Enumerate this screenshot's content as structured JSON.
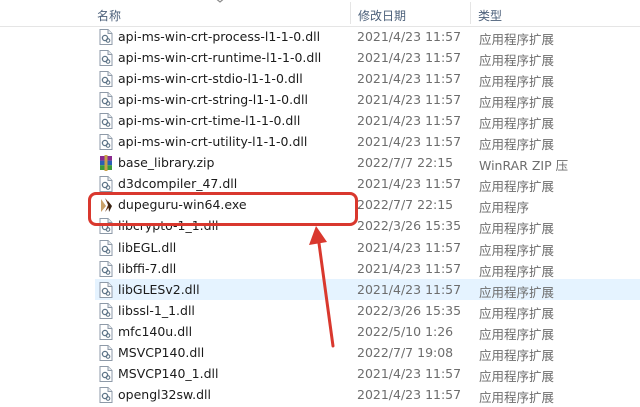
{
  "header": {
    "name_label": "名称",
    "date_label": "修改日期",
    "type_label": "类型"
  },
  "files": [
    {
      "name": "api-ms-win-crt-process-l1-1-0.dll",
      "date": "2021/4/23 11:57",
      "type": "应用程序扩展",
      "icon": "dll-icon"
    },
    {
      "name": "api-ms-win-crt-runtime-l1-1-0.dll",
      "date": "2021/4/23 11:57",
      "type": "应用程序扩展",
      "icon": "dll-icon"
    },
    {
      "name": "api-ms-win-crt-stdio-l1-1-0.dll",
      "date": "2021/4/23 11:57",
      "type": "应用程序扩展",
      "icon": "dll-icon"
    },
    {
      "name": "api-ms-win-crt-string-l1-1-0.dll",
      "date": "2021/4/23 11:57",
      "type": "应用程序扩展",
      "icon": "dll-icon"
    },
    {
      "name": "api-ms-win-crt-time-l1-1-0.dll",
      "date": "2021/4/23 11:57",
      "type": "应用程序扩展",
      "icon": "dll-icon"
    },
    {
      "name": "api-ms-win-crt-utility-l1-1-0.dll",
      "date": "2021/4/23 11:57",
      "type": "应用程序扩展",
      "icon": "dll-icon"
    },
    {
      "name": "base_library.zip",
      "date": "2022/7/7 22:15",
      "type": "WinRAR ZIP 压",
      "icon": "zip-archive-icon"
    },
    {
      "name": "d3dcompiler_47.dll",
      "date": "2021/4/23 11:57",
      "type": "应用程序扩展",
      "icon": "dll-icon"
    },
    {
      "name": "dupeguru-win64.exe",
      "date": "2022/7/7 22:15",
      "type": "应用程序",
      "icon": "app-icon"
    },
    {
      "name": "libcrypto-1_1.dll",
      "date": "2022/3/26 15:35",
      "type": "应用程序扩展",
      "icon": "dll-icon"
    },
    {
      "name": "libEGL.dll",
      "date": "2021/4/23 11:57",
      "type": "应用程序扩展",
      "icon": "dll-icon"
    },
    {
      "name": "libffi-7.dll",
      "date": "2021/4/23 11:57",
      "type": "应用程序扩展",
      "icon": "dll-icon"
    },
    {
      "name": "libGLESv2.dll",
      "date": "2021/4/23 11:57",
      "type": "应用程序扩展",
      "icon": "dll-icon",
      "selected": true
    },
    {
      "name": "libssl-1_1.dll",
      "date": "2022/3/26 15:35",
      "type": "应用程序扩展",
      "icon": "dll-icon"
    },
    {
      "name": "mfc140u.dll",
      "date": "2022/5/10 1:26",
      "type": "应用程序扩展",
      "icon": "dll-icon"
    },
    {
      "name": "MSVCP140.dll",
      "date": "2022/7/7 19:08",
      "type": "应用程序扩展",
      "icon": "dll-icon"
    },
    {
      "name": "MSVCP140_1.dll",
      "date": "2021/4/23 11:57",
      "type": "应用程序扩展",
      "icon": "dll-icon"
    },
    {
      "name": "opengl32sw.dll",
      "date": "2021/4/23 11:57",
      "type": "应用程序扩展",
      "icon": "dll-icon"
    }
  ],
  "colors": {
    "annotation": "#d9382e",
    "selection": "#e5f3ff"
  }
}
